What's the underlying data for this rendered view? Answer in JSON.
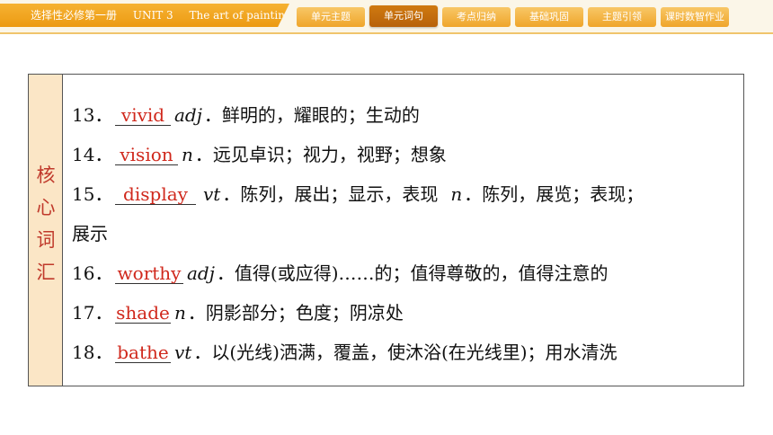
{
  "header": {
    "book": "选择性必修第一册",
    "unit": "UNIT 3",
    "unit_title": "The art of painting",
    "tabs": [
      {
        "label": "单元主题",
        "active": false
      },
      {
        "label": "单元词句",
        "active": true
      },
      {
        "label": "考点归纳",
        "active": false
      },
      {
        "label": "基础巩固",
        "active": false
      },
      {
        "label": "主题引领",
        "active": false
      },
      {
        "label": "课时数智作业",
        "active": false
      }
    ]
  },
  "side_label": [
    "核",
    "心",
    "词",
    "汇"
  ],
  "entries": [
    {
      "num": "13．",
      "answer": "vivid",
      "pos": "adj",
      "def": "．鲜明的，耀眼的；生动的"
    },
    {
      "num": "14．",
      "answer": "vision",
      "pos": "n",
      "def": "．远见卓识；视力，视野；想象"
    },
    {
      "num": "15．",
      "answer": "display",
      "pos": "vt",
      "def": "．陈列，展出；显示，表现",
      "pos2": "n",
      "def2": "．陈列，展览；表现；",
      "cont": "展示"
    },
    {
      "num": "16．",
      "answer": "worthy",
      "pos": "adj",
      "def": "．值得(或应得)……的；值得尊敬的，值得注意的"
    },
    {
      "num": "17．",
      "answer": "shade",
      "pos": "n",
      "def": "．阴影部分；色度；阴凉处"
    },
    {
      "num": "18．",
      "answer": "bathe",
      "pos": "vt",
      "def": "．以(光线)洒满，覆盖，使沐浴(在光线里)；用水清洗"
    }
  ]
}
